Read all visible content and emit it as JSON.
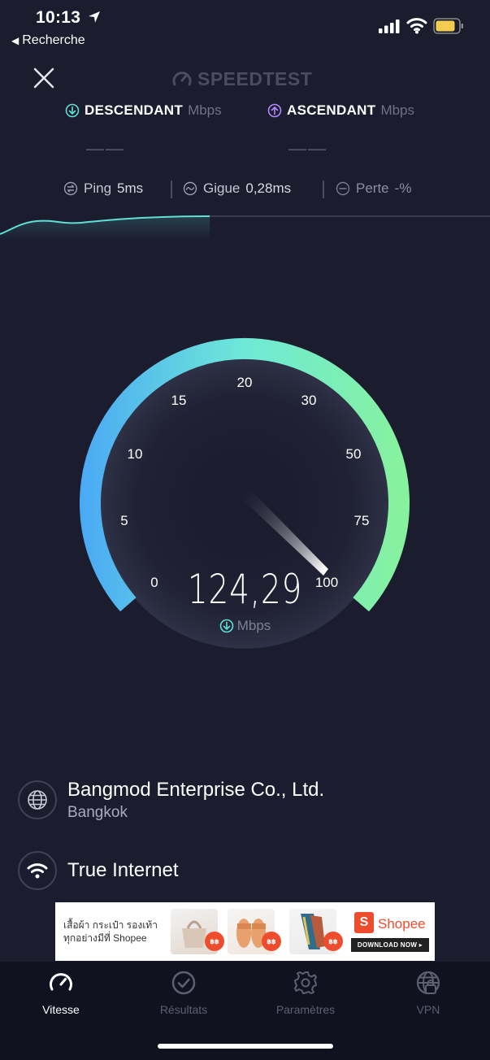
{
  "status_bar": {
    "time": "10:13",
    "back_label": "Recherche"
  },
  "header": {
    "brand": "SPEEDTEST"
  },
  "download": {
    "label": "DESCENDANT",
    "unit": "Mbps",
    "value": "——"
  },
  "upload": {
    "label": "ASCENDANT",
    "unit": "Mbps",
    "value": "——"
  },
  "metrics": {
    "ping": {
      "label": "Ping",
      "value": "5",
      "unit": "ms"
    },
    "jitter": {
      "label": "Gigue",
      "value": "0,28",
      "unit": "ms"
    },
    "loss": {
      "label": "Perte",
      "value": "-",
      "unit": "%"
    }
  },
  "gauge": {
    "ticks": [
      "0",
      "5",
      "10",
      "15",
      "20",
      "30",
      "50",
      "75",
      "100"
    ],
    "speed": "124,29",
    "unit": "Mbps",
    "progress": 1.0
  },
  "server": {
    "name": "Bangmod Enterprise Co., Ltd.",
    "city": "Bangkok"
  },
  "isp": {
    "name": "True Internet"
  },
  "ad": {
    "text_line1": "เสื้อผ้า กระเป๋า รองเท้า",
    "text_line2": "ทุกอย่างมีที่ Shopee",
    "brand": "Shopee",
    "cta": "DOWNLOAD NOW ▸",
    "badge1": "฿฿",
    "badge2": "฿฿",
    "badge3": "฿฿"
  },
  "tabs": [
    {
      "label": "Vitesse",
      "icon": "speedometer-icon",
      "active": true
    },
    {
      "label": "Résultats",
      "icon": "check-circle-icon",
      "active": false
    },
    {
      "label": "Paramètres",
      "icon": "gear-icon",
      "active": false
    },
    {
      "label": "VPN",
      "icon": "vpn-globe-icon",
      "active": false
    }
  ],
  "colors": {
    "background": "#1b1c2e",
    "gauge_start": "#4aa8f5",
    "gauge_mid": "#6ee9d8",
    "gauge_end": "#88f29a",
    "download_accent": "#5ee0d6",
    "upload_accent": "#b388ff"
  }
}
